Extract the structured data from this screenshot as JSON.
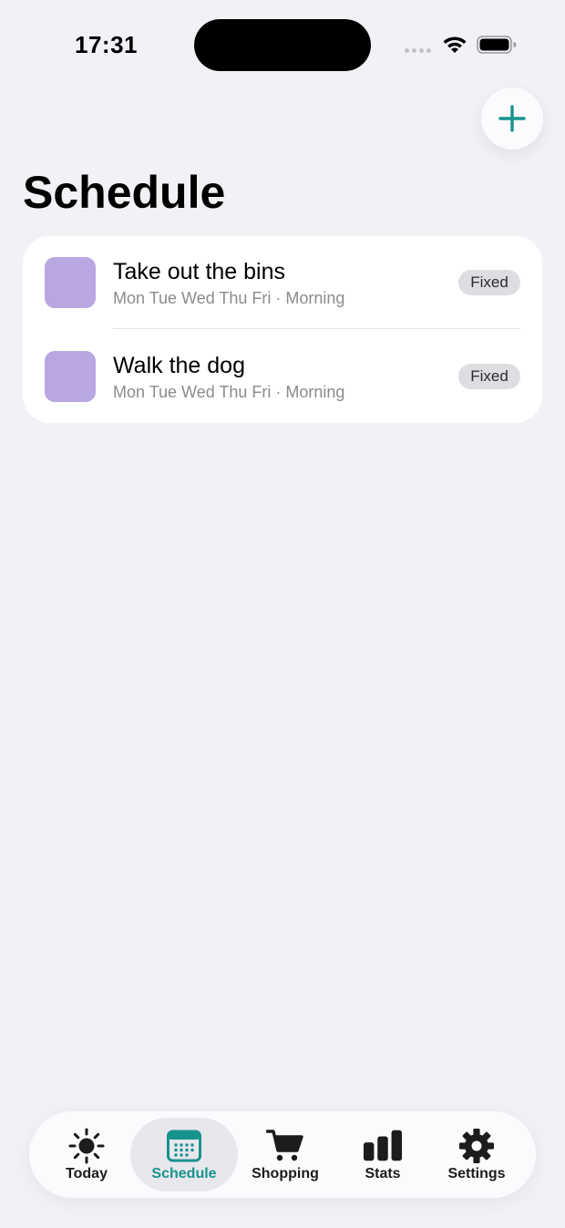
{
  "status_bar": {
    "time": "17:31"
  },
  "header": {
    "title": "Schedule"
  },
  "colors": {
    "accent": "#17938e",
    "task_swatch": "#b9a7e1",
    "background": "#f2f1f6"
  },
  "tasks": [
    {
      "title": "Take out the bins",
      "subtitle": "Mon Tue Wed Thu Fri · Morning",
      "badge": "Fixed"
    },
    {
      "title": "Walk the dog",
      "subtitle": "Mon Tue Wed Thu Fri · Morning",
      "badge": "Fixed"
    }
  ],
  "tabs": [
    {
      "label": "Today",
      "icon": "sun-icon"
    },
    {
      "label": "Schedule",
      "icon": "calendar-icon",
      "active": true
    },
    {
      "label": "Shopping",
      "icon": "cart-icon"
    },
    {
      "label": "Stats",
      "icon": "bar-chart-icon"
    },
    {
      "label": "Settings",
      "icon": "gear-icon"
    }
  ]
}
